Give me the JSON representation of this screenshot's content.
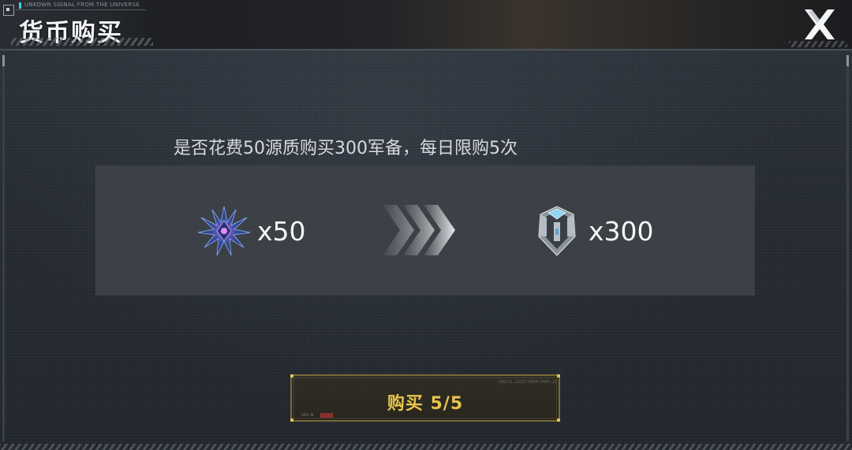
{
  "header": {
    "signal_text": "UNKOWN SIGNAL FROM THE UNIVERSE",
    "title": "货币购买"
  },
  "dialog": {
    "prompt": "是否花费50源质购买300军备，每日限购5次",
    "trade": {
      "source": {
        "icon": "crystal-icon",
        "quantity": "x50"
      },
      "target": {
        "icon": "armament-icon",
        "quantity": "x300"
      }
    },
    "buy_button": {
      "label": "购买 5/5",
      "code_left": "430/11.11117",
      "code_right": "0894-0495.21",
      "tag": "S11-N"
    }
  },
  "colors": {
    "accent_gold": "#e8c44d",
    "signal_cyan": "#3fd0d8",
    "panel_bg": "#252a31"
  }
}
